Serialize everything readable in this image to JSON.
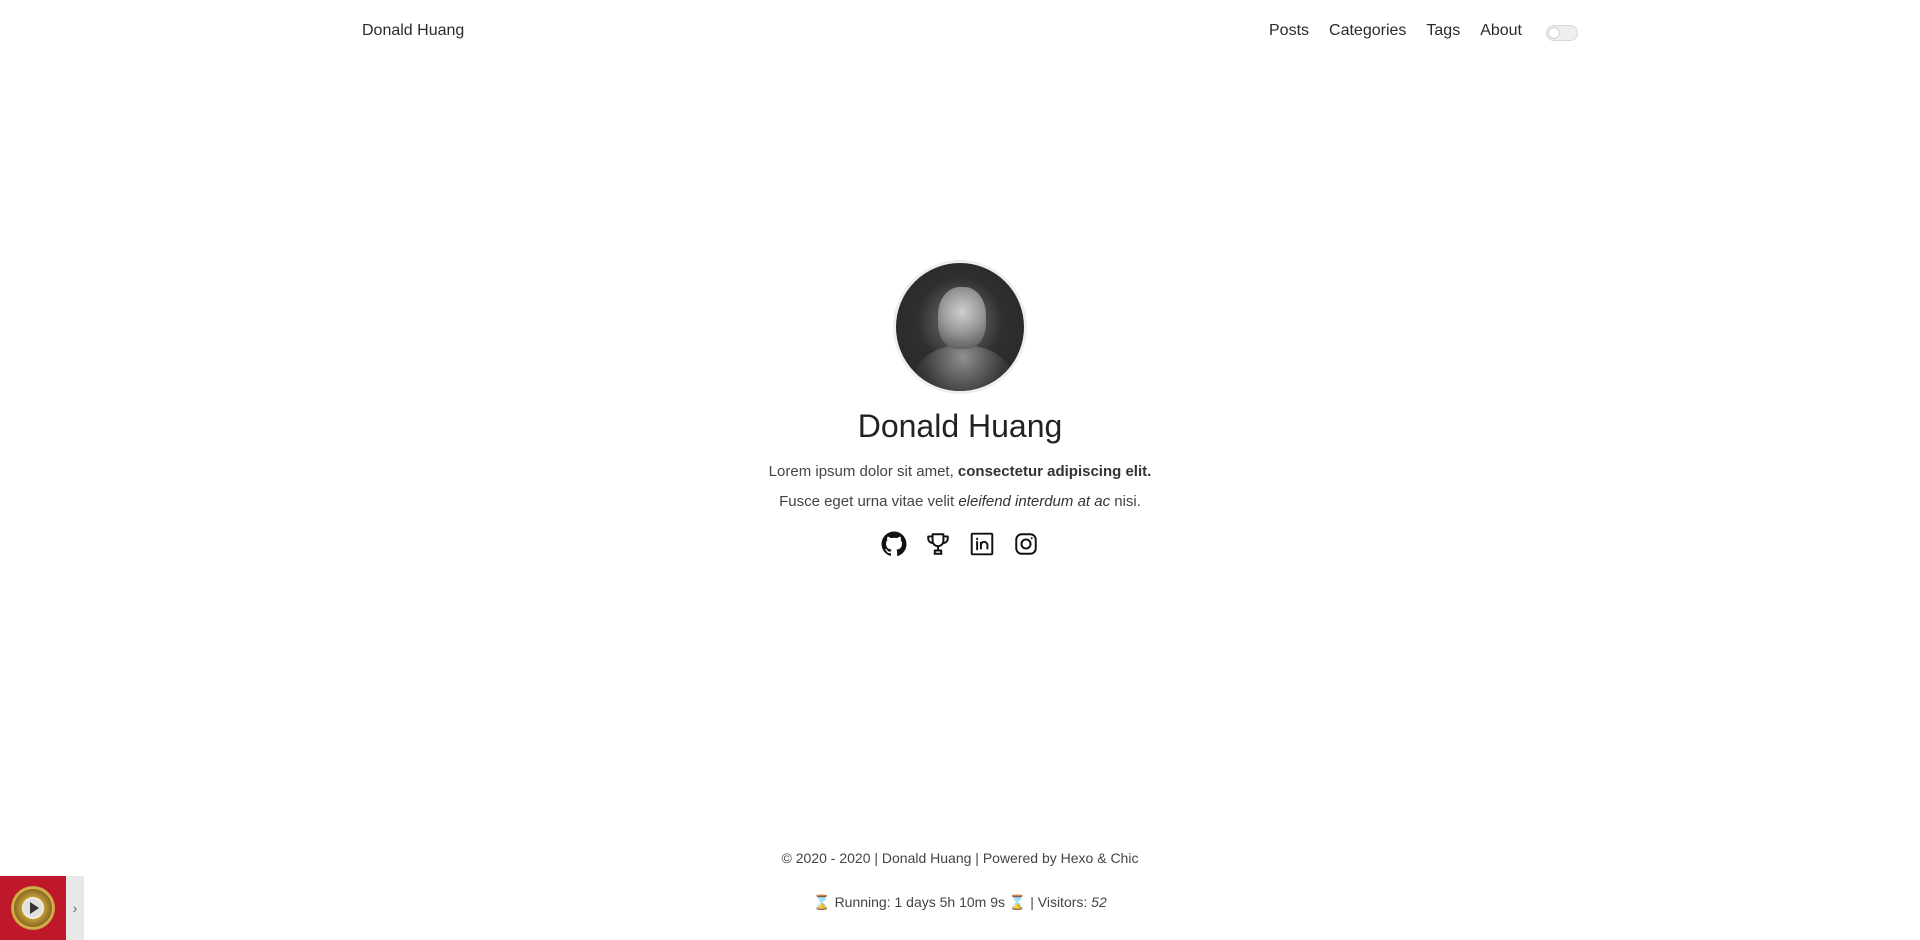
{
  "header": {
    "site_title": "Donald Huang",
    "nav": [
      {
        "label": "Posts"
      },
      {
        "label": "Categories"
      },
      {
        "label": "Tags"
      },
      {
        "label": "About"
      }
    ]
  },
  "profile": {
    "name": "Donald Huang",
    "desc_line1_plain": "Lorem ipsum dolor sit amet, ",
    "desc_line1_bold": "consectetur adipiscing elit.",
    "desc_line2_plain_start": "Fusce eget urna vitae velit ",
    "desc_line2_italic": "eleifend interdum at ac",
    "desc_line2_plain_end": " nisi.",
    "social_icons": [
      "github-icon",
      "trophy-icon",
      "linkedin-icon",
      "instagram-icon"
    ]
  },
  "footer": {
    "copyright": "© 2020 - 2020 | Donald Huang | Powered by Hexo & Chic",
    "running_prefix": "⌛ Running: 1 days 5h 10m 9s ⌛ | Visitors: ",
    "visitors": "52"
  },
  "music_player": {
    "expand_glyph": "›"
  }
}
